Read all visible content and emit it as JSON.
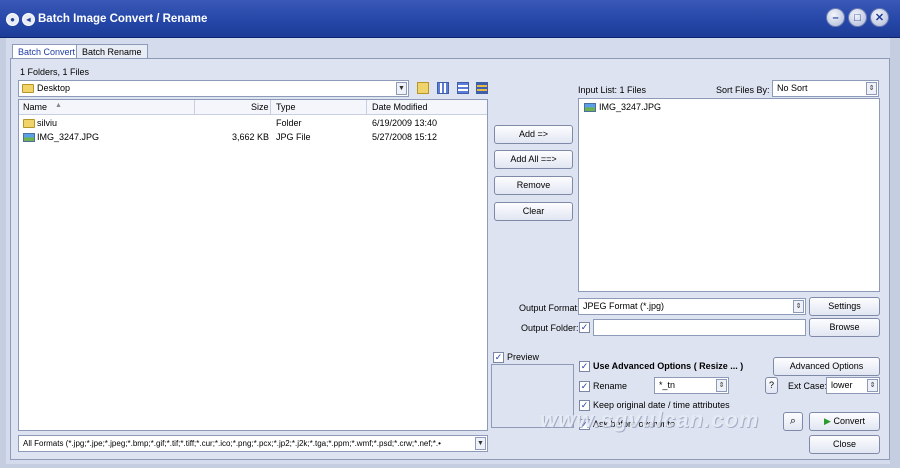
{
  "window": {
    "title": "Batch Image Convert / Rename"
  },
  "tabs": [
    {
      "label": "Batch Convert",
      "active": true
    },
    {
      "label": "Batch Rename",
      "active": false
    }
  ],
  "browser": {
    "summary": "1 Folders, 1 Files",
    "location": "Desktop",
    "columns": [
      "Name",
      "Size",
      "Type",
      "Date Modified"
    ],
    "rows": [
      {
        "icon": "folder-icon",
        "name": "silviu",
        "size": "",
        "type": "Folder",
        "date": "6/19/2009 13:40"
      },
      {
        "icon": "image-file-icon",
        "name": "IMG_3247.JPG",
        "size": "3,662 KB",
        "type": "JPG File",
        "date": "5/27/2008 15:12"
      }
    ],
    "filter": "All Formats (*.jpg;*.jpe;*.jpeg;*.bmp;*.gif;*.tif;*.tiff;*.cur;*.ico;*.png;*.pcx;*.jp2;*.j2k;*.tga;*.ppm;*.wmf;*.psd;*.crw;*.nef;*.•"
  },
  "actions": {
    "add": "Add =>",
    "add_all": "Add All ==>",
    "remove": "Remove",
    "clear": "Clear"
  },
  "input_list": {
    "label": "Input List:",
    "count": "1 Files",
    "sort_label": "Sort Files By:",
    "sort_value": "No Sort",
    "items": [
      "IMG_3247.JPG"
    ]
  },
  "output": {
    "format_label": "Output Format:",
    "format_value": "JPEG Format (*.jpg)",
    "settings": "Settings",
    "folder_label": "Output Folder:",
    "folder_value": "",
    "browse": "Browse"
  },
  "preview": {
    "label": "Preview",
    "checked": true
  },
  "options": {
    "advanced_label": "Use Advanced Options ( Resize ... )",
    "advanced_btn": "Advanced Options",
    "rename_label": "Rename",
    "rename_value": "*_tn",
    "help": "?",
    "ext_case_label": "Ext Case:",
    "ext_case_value": "lower",
    "keep_dates": "Keep original date / time attributes",
    "ask_overwrite": "Ask before overwrite"
  },
  "footer": {
    "convert": "Convert",
    "close": "Close"
  },
  "watermark": "www.sgvulcan.com"
}
